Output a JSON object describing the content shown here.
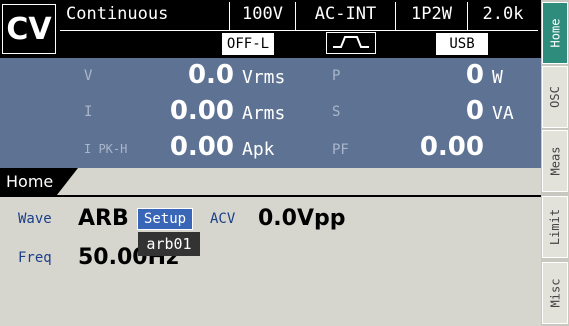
{
  "status": {
    "mode": "CV",
    "sequence": "Continuous",
    "range": "100V",
    "source": "AC-INT",
    "wiring": "1P2W",
    "frequency_range": "2.0k",
    "output": "OFF-L",
    "interface": "USB",
    "waveform_icon": "square-wave-icon"
  },
  "measurements": {
    "voltage": {
      "label": "V",
      "value": "0.0",
      "unit": "Vrms"
    },
    "current": {
      "label": "I",
      "value": "0.00",
      "unit": "Arms"
    },
    "peak_current": {
      "label": "I PK-H",
      "value": "0.00",
      "unit": "Apk"
    },
    "power": {
      "label": "P",
      "value": "0",
      "unit": "W"
    },
    "apparent_power": {
      "label": "S",
      "value": "0",
      "unit": "VA"
    },
    "power_factor": {
      "label": "PF",
      "value": "0.00"
    }
  },
  "home": {
    "title": "Home",
    "wave_label": "Wave",
    "wave_value": "ARB",
    "setup_label": "Setup",
    "acv_label": "ACV",
    "acv_value": "0.0Vpp",
    "freq_label": "Freq",
    "freq_value": "50.00Hz",
    "tooltip": "arb01"
  },
  "tabs": [
    "Home",
    "OSC",
    "Meas",
    "Limit",
    "Misc"
  ],
  "colors": {
    "meas_bg": "#5e7393",
    "active_tab": "#2e8c7c",
    "setup_button": "#3a66b8",
    "label_blue": "#1a3f87"
  }
}
